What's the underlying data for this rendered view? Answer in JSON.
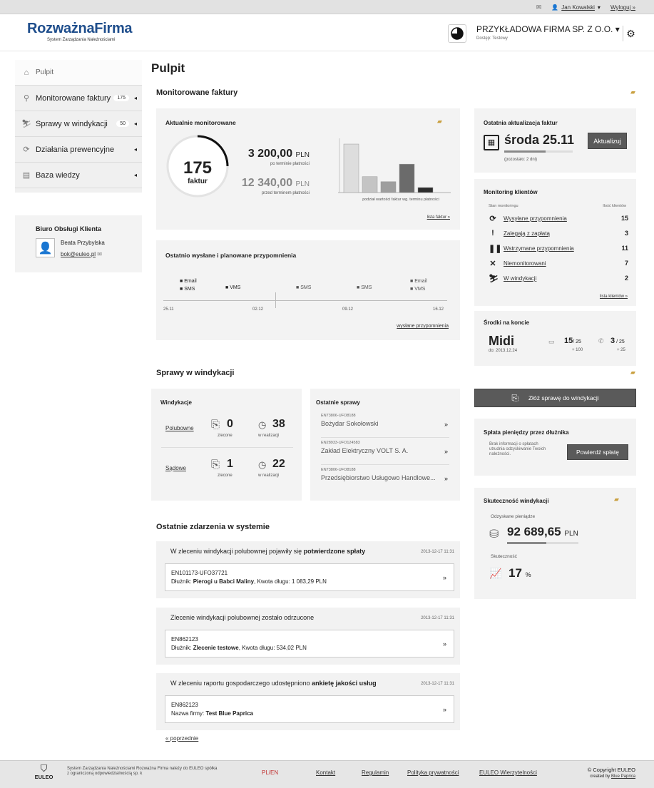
{
  "topbar": {
    "user": "Jan Kowalski",
    "logout": "Wyloguj »"
  },
  "header": {
    "logo_a": "Rozważna",
    "logo_b": "Firma",
    "logo_sub": "System Zarządzania Należnościami",
    "company": "PRZYKŁADOWA FIRMA SP. Z O.O.",
    "access": "Dostęp: Testowy"
  },
  "sidebar": {
    "items": [
      {
        "label": "Pulpit",
        "icon": "home-icon"
      },
      {
        "label": "Monitorowane faktury",
        "count": "175",
        "icon": "magnifier-icon"
      },
      {
        "label": "Sprawy w windykacji",
        "count": "50",
        "icon": "runner-icon"
      },
      {
        "label": "Działania prewencyjne",
        "icon": "refresh-icon"
      },
      {
        "label": "Baza wiedzy",
        "icon": "book-icon"
      }
    ],
    "office": {
      "title": "Biuro Obsługi Klienta",
      "name": "Beata Przybylska",
      "email": "bok@euleo.pl"
    }
  },
  "page_title": "Pulpit",
  "monitored": {
    "section_title": "Monitorowane faktury",
    "panel_title": "Aktualnie monitorowane",
    "count": "175",
    "count_label": "faktur",
    "amount_due": "3 200,00",
    "amount_due_note": "po terminie płatności",
    "amount_before": "12 340,00",
    "amount_before_note": "przed terminem płatności",
    "currency": "PLN",
    "chart_caption": "podział wartości faktur wg. terminu płatności",
    "list_link": "lista faktur »"
  },
  "chart_data": {
    "type": "bar",
    "categories": [
      "1",
      "2",
      "3",
      "4",
      "5"
    ],
    "values": [
      58,
      19,
      13,
      34,
      6
    ],
    "ylim": [
      0,
      64
    ],
    "xlabel": "podział wartości faktur wg. terminu płatności",
    "colors": [
      "#dddddd",
      "#c4c4c4",
      "#9e9e9e",
      "#6b6b6b",
      "#2b2b2b"
    ]
  },
  "reminders": {
    "title": "Ostatnio wysłane i planowane przypomnienia",
    "ticks": [
      "25.11",
      "02.12",
      "09.12",
      "16.12"
    ],
    "groups": [
      [
        "Email",
        "SMS"
      ],
      [
        "VMS"
      ],
      [
        "SMS"
      ],
      [
        "SMS"
      ],
      [
        "Email",
        "VMS"
      ]
    ],
    "link": "wysłane przypomnienia"
  },
  "update": {
    "title": "Ostatnia aktualizacja faktur",
    "date": "środa 25.11",
    "left": "(pozostało: 2 dni)",
    "button": "Aktualizuj"
  },
  "clients": {
    "title": "Monitoring klientów",
    "col1": "Stan monitoringu",
    "col2": "Ilość klientów",
    "rows": [
      {
        "label": "Wysyłane przypomnienia",
        "value": "15",
        "icon": "refresh-icon"
      },
      {
        "label": "Zalegają z zapłatą",
        "value": "3",
        "icon": "exclamation-icon"
      },
      {
        "label": "Wstrzymane przypomnienia",
        "value": "11",
        "icon": "pause-icon"
      },
      {
        "label": "Niemonitorowani",
        "value": "7",
        "icon": "cross-icon"
      },
      {
        "label": "W windykacji",
        "value": "2",
        "icon": "runner-icon"
      }
    ],
    "link": "lista klientów »"
  },
  "funds": {
    "title": "Środki na koncie",
    "plan": "Midi",
    "plan_date": "do: 2013.12.24",
    "sms": "15",
    "sms_total": "25",
    "sms_extra": "+ 100",
    "calls": "3",
    "calls_total": "25",
    "calls_extra": "+ 25"
  },
  "collection": {
    "section_title": "Sprawy w windykacji",
    "panel_title": "Windykacje",
    "amicable": "Polubowne",
    "amicable_ordered": "0",
    "amicable_progress": "38",
    "court": "Sądowe",
    "court_ordered": "1",
    "court_progress": "22",
    "ordered_label": "zlecone",
    "progress_label": "w realizacji"
  },
  "recent_cases": {
    "title": "Ostatnie sprawy",
    "items": [
      {
        "id": "EN73806-UFO8188",
        "name": "Bożydar Sokołowski"
      },
      {
        "id": "EN28933-UFO124583",
        "name": "Zakład Elektryczny VOLT S. A."
      },
      {
        "id": "EN73806-UFO8188",
        "name": "Przedsiębiorstwo Usługowo Handlowe..."
      }
    ]
  },
  "submit_case": "Złóż sprawę do windykacji",
  "payment": {
    "title": "Spłata pieniędzy przez dłużnika",
    "text": "Brak informacji o spłatach utrudnia odzyskiwanie Twoich należności.",
    "button": "Powierdź spłatę"
  },
  "effectiveness": {
    "title": "Skuteczność windykacji",
    "recovered_label": "Odzyskane pieniądze",
    "recovered": "92 689,65",
    "currency": "PLN",
    "eff_label": "Skuteczność",
    "eff": "17",
    "pct": "%",
    "recovered_fill": 0.55
  },
  "events": {
    "title": "Ostatnie zdarzenia w systemie",
    "items": [
      {
        "t1": "W zleceniu windykacji polubownej pojawiły się ",
        "t2": "potwierdzone spłaty",
        "date": "2013-12-17 11:31",
        "id": "EN101173-UFO37721",
        "l1": "Dłużnik: ",
        "b1": "Pierogi u Babci Maliny",
        "l2": ", Kwota długu: 1 083,29 PLN"
      },
      {
        "t1": "Zlecenie windykacji polubownej zostało odrzucone",
        "t2": "",
        "date": "2013-12-17 11:31",
        "id": "EN862123",
        "l1": "Dłużnik: ",
        "b1": "Zlecenie testowe",
        "l2": ", Kwota długu: 534,02 PLN"
      },
      {
        "t1": "W zleceniu raportu gospodarczego udostępniono ",
        "t2": "ankietę jakości usług",
        "date": "2013-12-17 11:31",
        "id": "EN862123",
        "l1": "Nazwa firmy: ",
        "b1": "Test Blue Paprica",
        "l2": ""
      }
    ],
    "prev": "« poprzednie"
  },
  "footer": {
    "brand": "EULEO",
    "legal": "System Zarządzania Należnościami Rozważna Firma należy do EULEO spółka z ograniczoną odpowiedzialnością sp. k",
    "lang": "PL/EN",
    "links": [
      "Kontakt",
      "Regulamin",
      "Polityka prywatności",
      "EULEO Wierzytelności"
    ],
    "copyright": "© Copyright EULEO",
    "created": "created by",
    "creator": "Blue Paprica"
  }
}
